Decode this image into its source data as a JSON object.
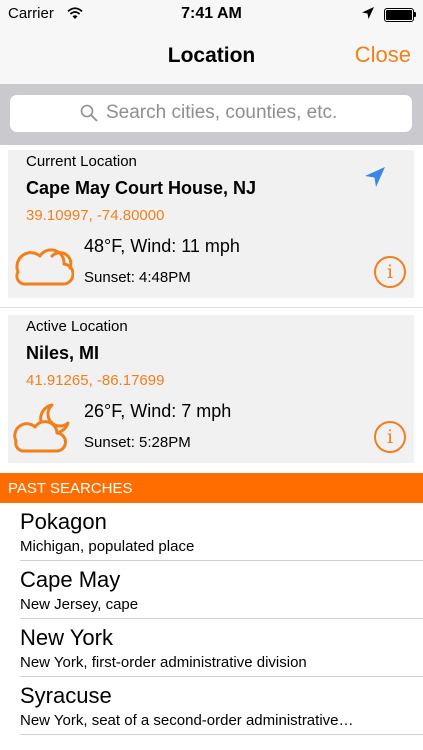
{
  "status_bar": {
    "carrier": "Carrier",
    "time": "7:41 AM",
    "icons": [
      "wifi-icon",
      "location-arrow-icon",
      "battery-icon"
    ]
  },
  "nav": {
    "title": "Location",
    "close_label": "Close"
  },
  "search": {
    "placeholder": "Search cities, counties, etc."
  },
  "cards": [
    {
      "kind": "Current Location",
      "name": "Cape May Court House, NJ",
      "coords": "39.10997, -74.80000",
      "conditions": "48°F, Wind: 11 mph",
      "sunset": "Sunset: 4:48PM",
      "weather_icon": "cloudy-icon",
      "has_location_arrow": true
    },
    {
      "kind": "Active Location",
      "name": "Niles, MI",
      "coords": "41.91265, -86.17699",
      "conditions": "26°F, Wind: 7 mph",
      "sunset": "Sunset: 5:28PM",
      "weather_icon": "night-cloudy-icon",
      "has_location_arrow": false
    }
  ],
  "past_searches": {
    "header": "PAST SEARCHES",
    "items": [
      {
        "name": "Pokagon",
        "desc": "Michigan, populated place"
      },
      {
        "name": "Cape May",
        "desc": "New Jersey, cape"
      },
      {
        "name": "New York",
        "desc": "New York, first-order administrative division"
      },
      {
        "name": "Syracuse",
        "desc": "New York, seat of a second-order administrative…"
      }
    ]
  },
  "colors": {
    "accent": "#f07f1c",
    "section_header": "#ff6c00",
    "location_arrow": "#3a86e6"
  }
}
